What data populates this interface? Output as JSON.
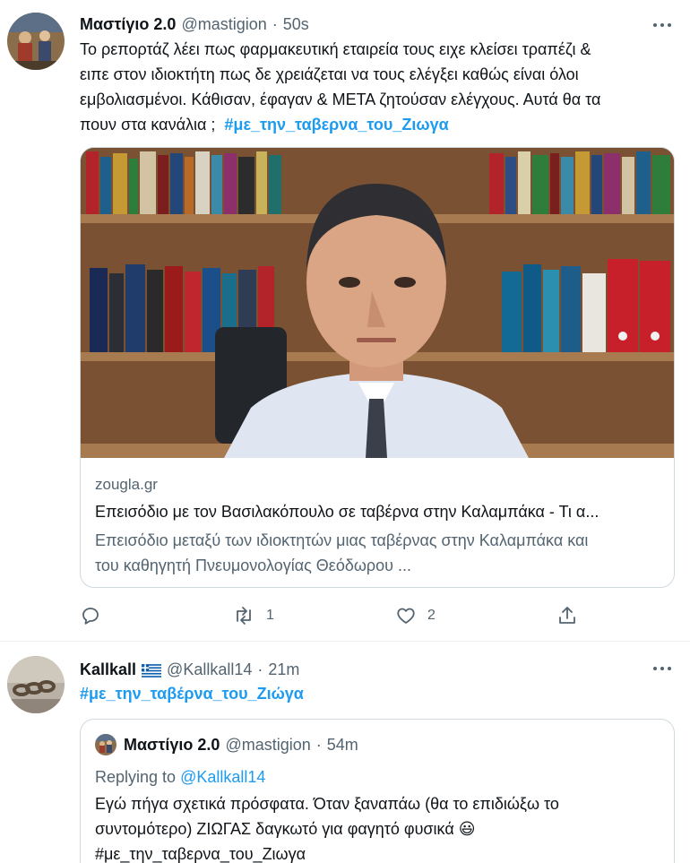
{
  "tweet1": {
    "name": "Μαστίγιο 2.0",
    "handle": "@mastigion",
    "dot": "·",
    "time": "50s",
    "text_lines": [
      "Το ρεπορτάζ λέει πως φαρμακευτική εταιρεία τους ειχε κλείσει τραπέζι &",
      "ειπε στον ιδιοκτήτη πως δε χρειάζεται να τους ελέγξει καθώς είναι όλοι",
      "εμβολιασμένοι. Κάθισαν, έφαγαν & ΜΕΤΑ ζητούσαν ελέγχους. Αυτά θα τα",
      "πουν στα κανάλια ;"
    ],
    "hashtag": "#με_την_ταβερνα_του_Ζιωγα",
    "card": {
      "domain": "zougla.gr",
      "title": "Επεισόδιο με τον Βασιλακόπουλο σε ταβέρνα στην Καλαμπάκα - Τι α...",
      "desc_lines": [
        "Επεισόδιο μεταξύ των ιδιοκτητών μιας ταβέρνας στην Καλαμπάκα και",
        "του καθηγητή Πνευμονολογίας Θεόδωρου ..."
      ]
    },
    "actions": {
      "reply_count": "",
      "retweet_count": "1",
      "like_count": "2"
    }
  },
  "tweet2": {
    "name": "Kallkall",
    "flag": "greece-flag-icon",
    "handle": "@Kallkall14",
    "dot": "·",
    "time": "21m",
    "hashtag": "#με_την_ταβέρνα_του_Ζιώγα",
    "quote": {
      "name": "Μαστίγιο 2.0",
      "handle": "@mastigion",
      "dot": "·",
      "time": "54m",
      "replying_prefix": "Replying to",
      "replying_to": "@Kallkall14",
      "text_lines": [
        "Εγώ πήγα σχετικά πρόσφατα. Όταν ξαναπάω (θα το επιδιώξω το",
        "συντομότερο) ΖΙΩΓΑΣ δαγκωτό για φαγητό φυσικά"
      ],
      "emoji": "😃",
      "hashtag": "#με_την_ταβερνα_του_Ζιωγα"
    }
  },
  "colors": {
    "link": "#1d9bf0",
    "secondary": "#536471",
    "text": "#0f1419",
    "border": "#cfd9de"
  }
}
